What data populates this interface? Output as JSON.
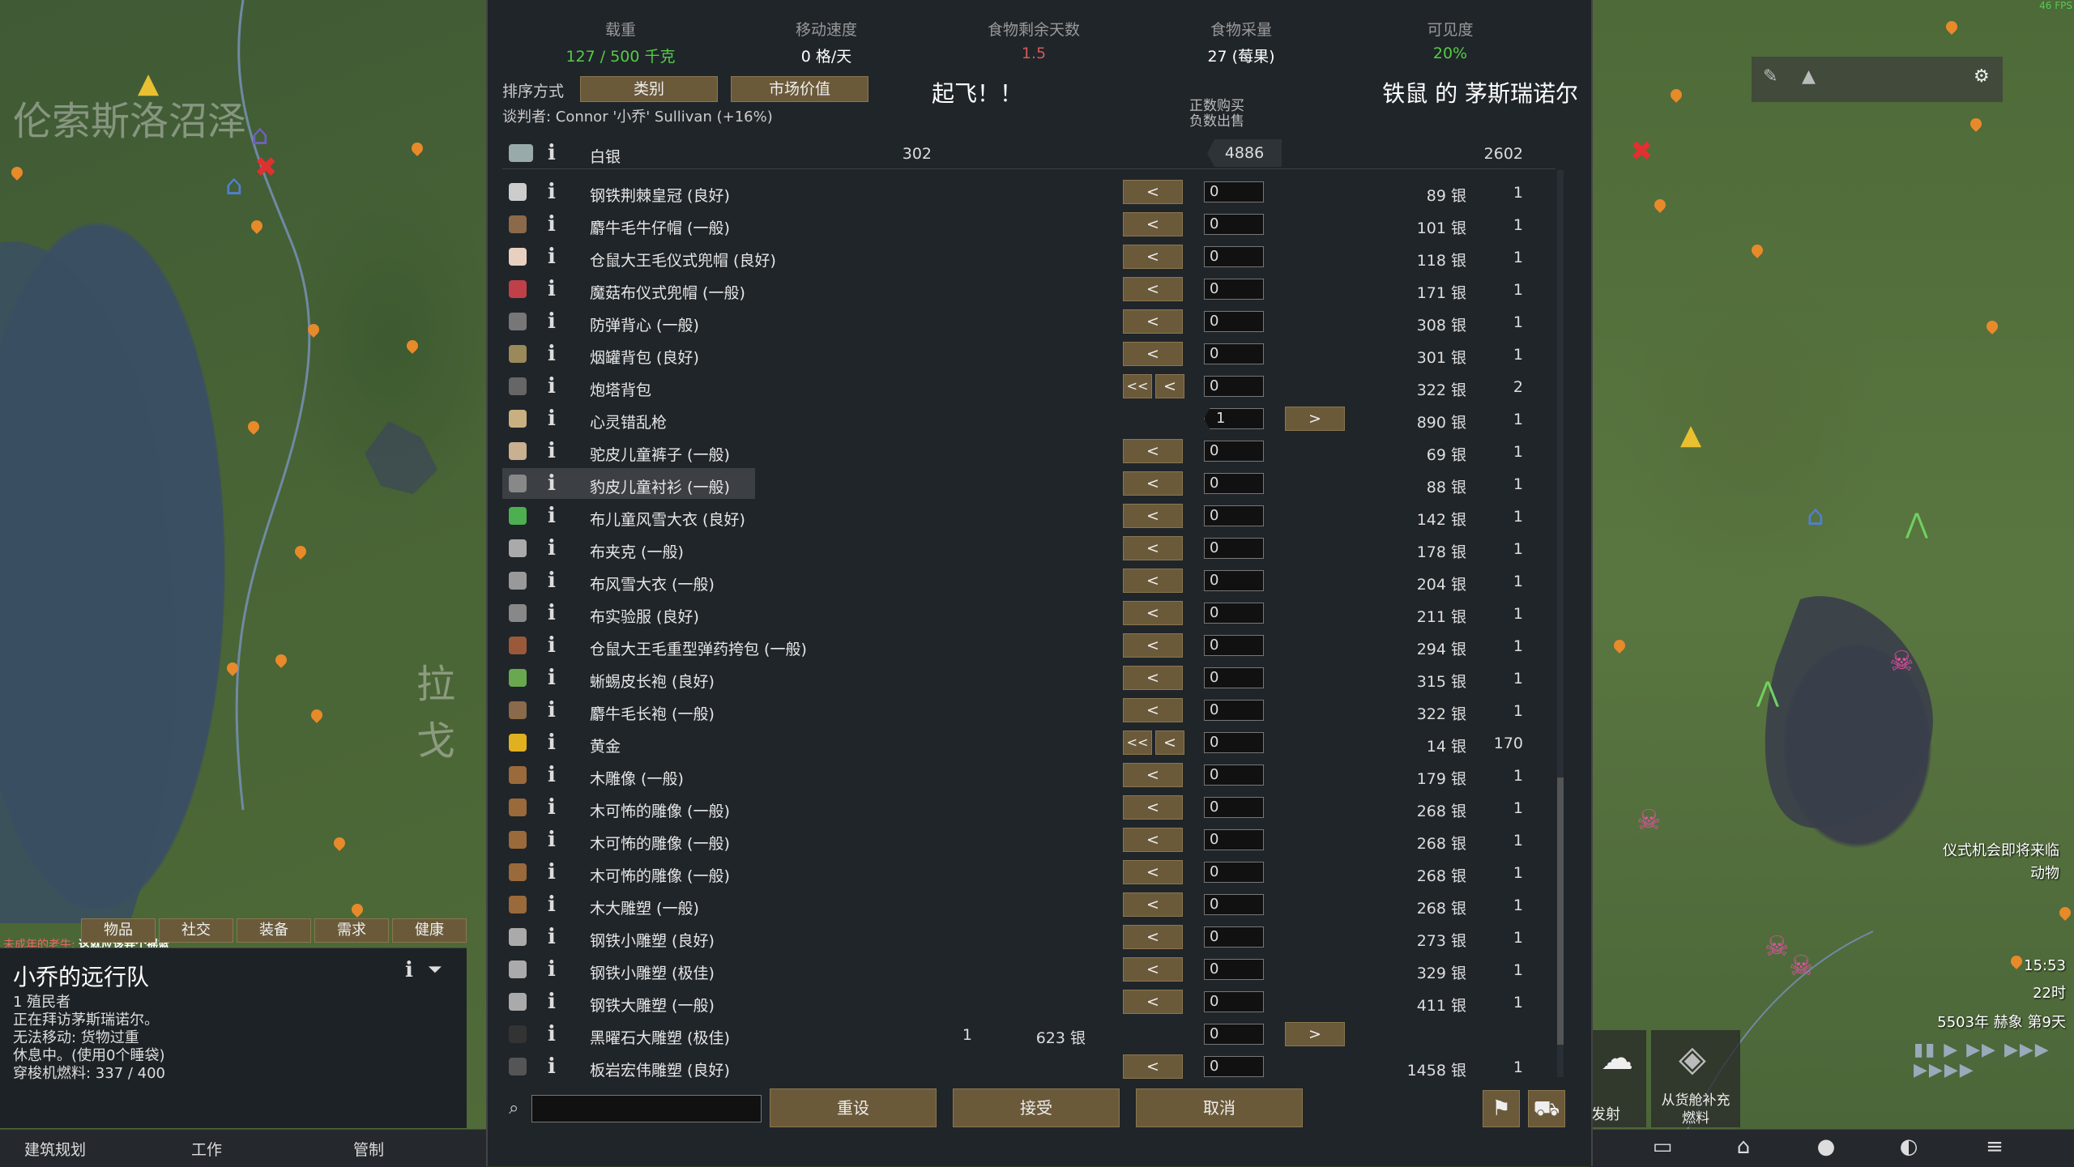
{
  "map": {
    "region_left": "伦索斯洛沼泽",
    "region_mid": "拉戈"
  },
  "fps": "46 FPS",
  "stats": [
    {
      "label": "载重",
      "value": "127 / 500 千克",
      "color": "green"
    },
    {
      "label": "移动速度",
      "value": "0 格/天",
      "color": "white"
    },
    {
      "label": "食物剩余天数",
      "value": "1.5",
      "color": "red"
    },
    {
      "label": "食物采量",
      "value": "27 (莓果)",
      "color": "white"
    },
    {
      "label": "可见度",
      "value": "20%",
      "color": "green"
    }
  ],
  "sort": {
    "label": "排序方式",
    "btn1": "类别",
    "btn2": "市场价值"
  },
  "title_left": "起飞！！",
  "title_right": "铁鼠 的 茅斯瑞诺尔",
  "negotiator": "谈判者: Connor '小乔' Sullivan (+16%)",
  "header_buy": "正数购买",
  "header_sell": "负数出售",
  "silver_row": {
    "name": "白银",
    "left_count": "302",
    "value": "4886",
    "right_count": "2602"
  },
  "rows": [
    {
      "name": "钢铁荆棘皇冠 (良好)",
      "price": "89 银",
      "rcount": "1",
      "input": "0",
      "icon": "#ccc",
      "lcount": "",
      "lprice": "",
      "mode": "single"
    },
    {
      "name": "麝牛毛牛仔帽 (一般)",
      "price": "101 银",
      "rcount": "1",
      "input": "0",
      "icon": "#8a6a4a",
      "lcount": "",
      "lprice": "",
      "mode": "single"
    },
    {
      "name": "仓鼠大王毛仪式兜帽 (良好)",
      "price": "118 银",
      "rcount": "1",
      "input": "0",
      "icon": "#e8d0c0",
      "lcount": "",
      "lprice": "",
      "mode": "single"
    },
    {
      "name": "魔菇布仪式兜帽 (一般)",
      "price": "171 银",
      "rcount": "1",
      "input": "0",
      "icon": "#c0404a",
      "lcount": "",
      "lprice": "",
      "mode": "single"
    },
    {
      "name": "防弹背心 (一般)",
      "price": "308 银",
      "rcount": "1",
      "input": "0",
      "icon": "#777",
      "lcount": "",
      "lprice": "",
      "mode": "single"
    },
    {
      "name": "烟罐背包 (良好)",
      "price": "301 银",
      "rcount": "1",
      "input": "0",
      "icon": "#9a8a5a",
      "lcount": "",
      "lprice": "",
      "mode": "single"
    },
    {
      "name": "炮塔背包",
      "price": "322 银",
      "rcount": "2",
      "input": "0",
      "icon": "#666",
      "lcount": "",
      "lprice": "",
      "mode": "double"
    },
    {
      "name": "心灵错乱枪",
      "price": "890 银",
      "rcount": "1",
      "input": "1",
      "icon": "#c8b080",
      "lcount": "",
      "lprice": "",
      "mode": "buy"
    },
    {
      "name": "驼皮儿童裤子 (一般)",
      "price": "69 银",
      "rcount": "1",
      "input": "0",
      "icon": "#c8b090",
      "lcount": "",
      "lprice": "",
      "mode": "single"
    },
    {
      "name": "豹皮儿童衬衫 (一般)",
      "price": "88 银",
      "rcount": "1",
      "input": "0",
      "icon": "#888",
      "lcount": "",
      "lprice": "",
      "mode": "single"
    },
    {
      "name": "布儿童风雪大衣 (良好)",
      "price": "142 银",
      "rcount": "1",
      "input": "0",
      "icon": "#4caf50",
      "lcount": "",
      "lprice": "",
      "mode": "single"
    },
    {
      "name": "布夹克 (一般)",
      "price": "178 银",
      "rcount": "1",
      "input": "0",
      "icon": "#aaa",
      "lcount": "",
      "lprice": "",
      "mode": "single"
    },
    {
      "name": "布风雪大衣 (一般)",
      "price": "204 银",
      "rcount": "1",
      "input": "0",
      "icon": "#999",
      "lcount": "",
      "lprice": "",
      "mode": "single"
    },
    {
      "name": "布实验服 (良好)",
      "price": "211 银",
      "rcount": "1",
      "input": "0",
      "icon": "#888",
      "lcount": "",
      "lprice": "",
      "mode": "single"
    },
    {
      "name": "仓鼠大王毛重型弹药挎包 (一般)",
      "price": "294 银",
      "rcount": "1",
      "input": "0",
      "icon": "#9a5a3a",
      "lcount": "",
      "lprice": "",
      "mode": "single"
    },
    {
      "name": "蜥蜴皮长袍 (良好)",
      "price": "315 银",
      "rcount": "1",
      "input": "0",
      "icon": "#6aa84f",
      "lcount": "",
      "lprice": "",
      "mode": "single"
    },
    {
      "name": "麝牛毛长袍 (一般)",
      "price": "322 银",
      "rcount": "1",
      "input": "0",
      "icon": "#8a6a4a",
      "lcount": "",
      "lprice": "",
      "mode": "single"
    },
    {
      "name": "黄金",
      "price": "14 银",
      "rcount": "170",
      "input": "0",
      "icon": "#e0b020",
      "lcount": "",
      "lprice": "",
      "mode": "double"
    },
    {
      "name": "木雕像 (一般)",
      "price": "179 银",
      "rcount": "1",
      "input": "0",
      "icon": "#9a6a3a",
      "lcount": "",
      "lprice": "",
      "mode": "single"
    },
    {
      "name": "木可怖的雕像 (一般)",
      "price": "268 银",
      "rcount": "1",
      "input": "0",
      "icon": "#9a6a3a",
      "lcount": "",
      "lprice": "",
      "mode": "single"
    },
    {
      "name": "木可怖的雕像 (一般)",
      "price": "268 银",
      "rcount": "1",
      "input": "0",
      "icon": "#9a6a3a",
      "lcount": "",
      "lprice": "",
      "mode": "single"
    },
    {
      "name": "木可怖的雕像 (一般)",
      "price": "268 银",
      "rcount": "1",
      "input": "0",
      "icon": "#9a6a3a",
      "lcount": "",
      "lprice": "",
      "mode": "single"
    },
    {
      "name": "木大雕塑 (一般)",
      "price": "268 银",
      "rcount": "1",
      "input": "0",
      "icon": "#9a6a3a",
      "lcount": "",
      "lprice": "",
      "mode": "single"
    },
    {
      "name": "钢铁小雕塑 (良好)",
      "price": "273 银",
      "rcount": "1",
      "input": "0",
      "icon": "#aaa",
      "lcount": "",
      "lprice": "",
      "mode": "single"
    },
    {
      "name": "钢铁小雕塑 (极佳)",
      "price": "329 银",
      "rcount": "1",
      "input": "0",
      "icon": "#aaa",
      "lcount": "",
      "lprice": "",
      "mode": "single"
    },
    {
      "name": "钢铁大雕塑 (一般)",
      "price": "411 银",
      "rcount": "1",
      "input": "0",
      "icon": "#aaa",
      "lcount": "",
      "lprice": "",
      "mode": "single"
    },
    {
      "name": "黑曜石大雕塑 (极佳)",
      "price": "",
      "rcount": "",
      "input": "0",
      "icon": "#333",
      "lcount": "1",
      "lprice": "623 银",
      "mode": "sell"
    },
    {
      "name": "板岩宏伟雕塑 (良好)",
      "price": "1458 银",
      "rcount": "1",
      "input": "0",
      "icon": "#555",
      "lcount": "",
      "lprice": "",
      "mode": "single"
    }
  ],
  "buttons": {
    "left": "<",
    "double_left": "<<",
    "right": ">",
    "reset": "重设",
    "accept": "接受",
    "cancel": "取消"
  },
  "caravan": {
    "tabs": [
      "物品",
      "社交",
      "装备",
      "需求",
      "健康"
    ],
    "alert_prefix": "未成年的老牛:",
    "alert_text": "这就应该弄个摇篮",
    "title": "小乔的远行队",
    "lines": [
      "1 殖民者",
      "正在拜访茅斯瑞诺尔。",
      "无法移动: 货物过重",
      "休息中。(使用0个睡袋)",
      "穿梭机燃料: 337 / 400"
    ]
  },
  "arch_bar": [
    "建筑规划",
    "工作",
    "管制"
  ],
  "right_panel": {
    "event1": "仪式机会即将来临",
    "event2": "动物",
    "time": "15:53",
    "hour": "22时",
    "date": "5503年 赫象 第9天",
    "launch": "发射",
    "refuel1": "从货舱补充",
    "refuel2": "燃料"
  }
}
